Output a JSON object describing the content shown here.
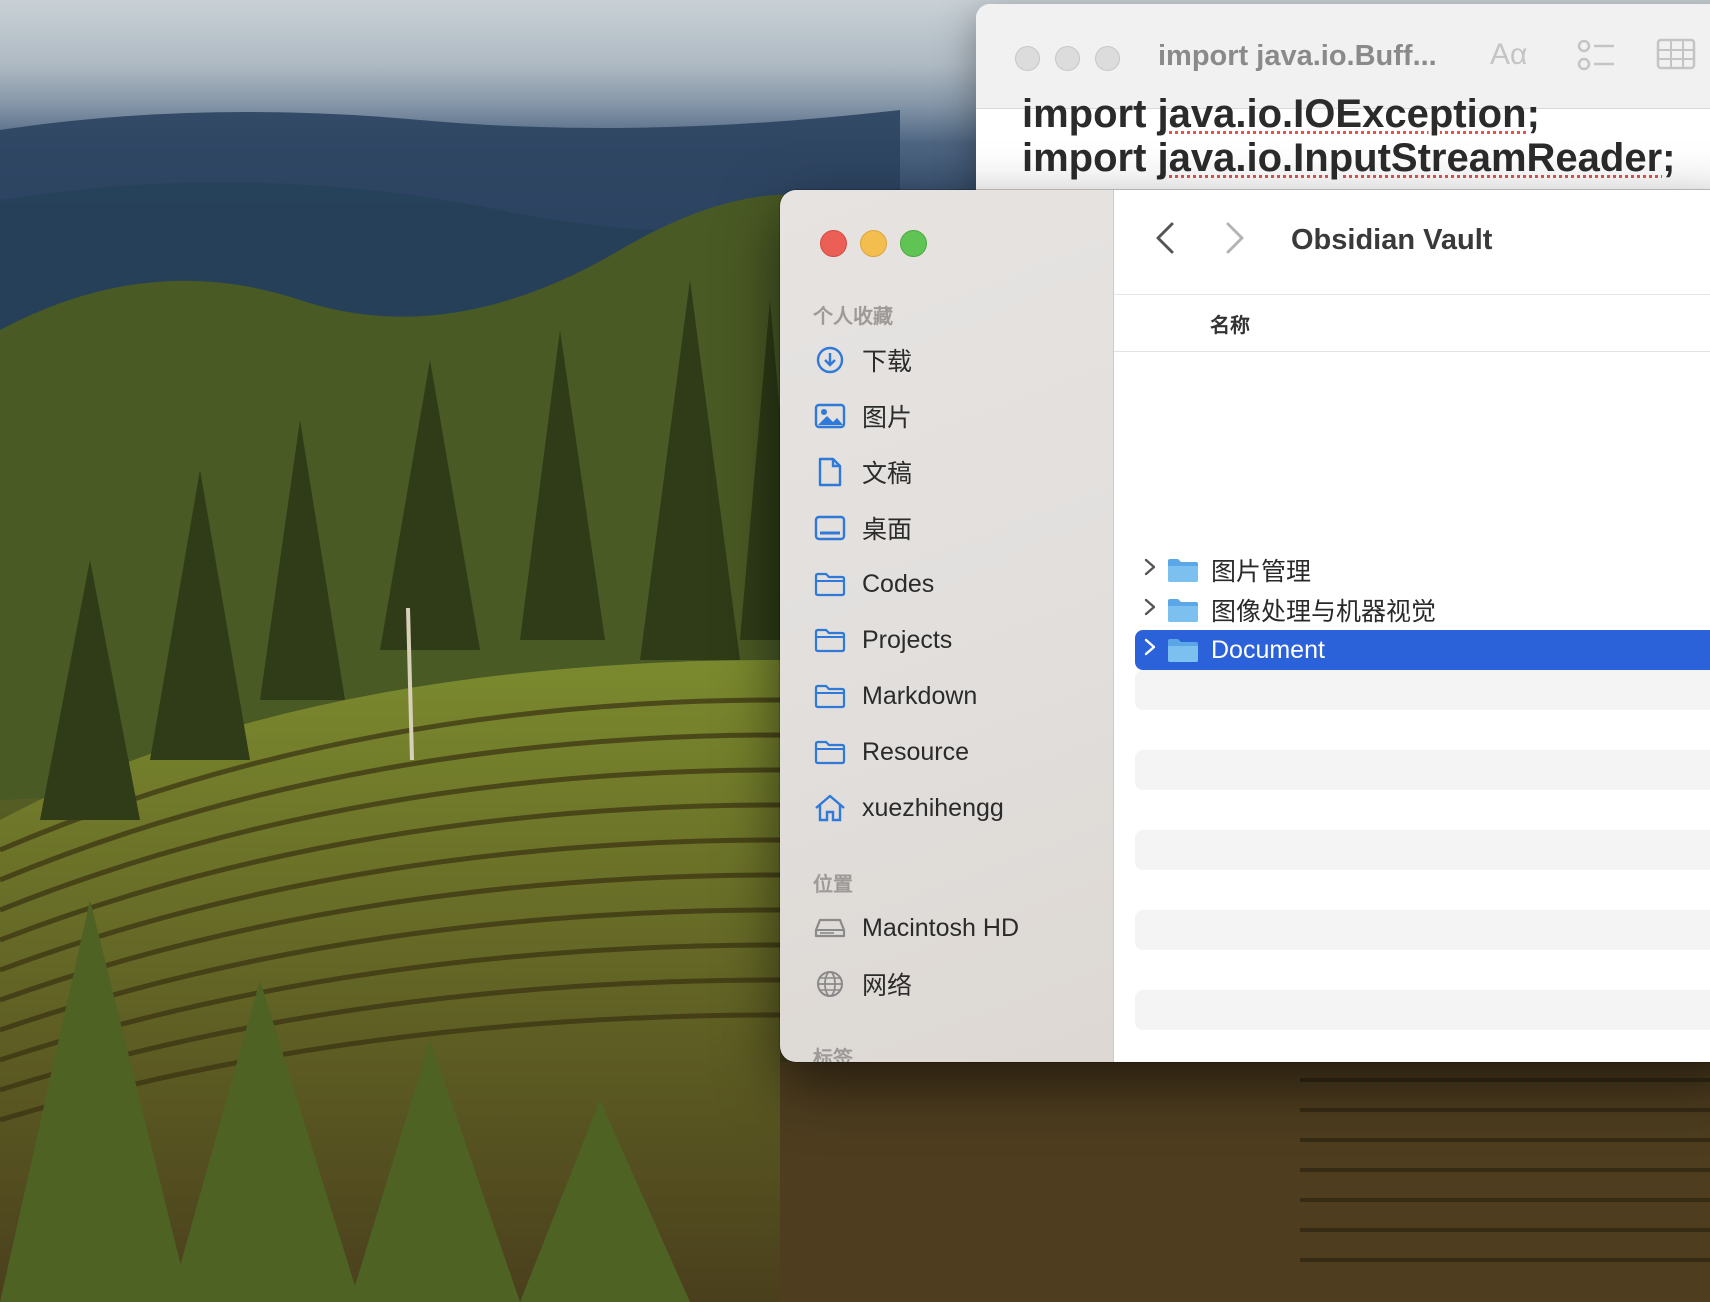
{
  "textedit": {
    "title": "import java.io.Buff...",
    "toolbar_icons": [
      "font-icon",
      "checklist-icon",
      "table-icon"
    ],
    "font_icon_text": "Aα",
    "code_lines": [
      {
        "prefix": "import ",
        "code": "java.io.IOException",
        "suffix": ";"
      },
      {
        "prefix": "import ",
        "code": "java.io.InputStreamReader",
        "suffix": ";"
      }
    ]
  },
  "finder": {
    "path_title": "Obsidian Vault",
    "column_header": "名称",
    "sidebar": {
      "favorites_title": "个人收藏",
      "favorites": [
        {
          "label": "下载",
          "icon": "download-icon"
        },
        {
          "label": "图片",
          "icon": "photos-icon"
        },
        {
          "label": "文稿",
          "icon": "document-icon"
        },
        {
          "label": "桌面",
          "icon": "desktop-icon"
        },
        {
          "label": "Codes",
          "icon": "folder-icon"
        },
        {
          "label": "Projects",
          "icon": "folder-icon"
        },
        {
          "label": "Markdown",
          "icon": "folder-icon"
        },
        {
          "label": "Resource",
          "icon": "folder-icon"
        },
        {
          "label": "xuezhihengg",
          "icon": "home-icon"
        }
      ],
      "locations_title": "位置",
      "locations": [
        {
          "label": "Macintosh HD",
          "icon": "harddisk-icon"
        },
        {
          "label": "网络",
          "icon": "network-icon"
        }
      ],
      "tags_title": "标签"
    },
    "rows": [
      {
        "name": "图片管理",
        "selected": false
      },
      {
        "name": "图像处理与机器视觉",
        "selected": false
      },
      {
        "name": "Document",
        "selected": true
      }
    ],
    "colors": {
      "selection": "#2c62d9",
      "folder": "#6fb3e8",
      "sidebar_icon": "#2f7ad8"
    }
  }
}
